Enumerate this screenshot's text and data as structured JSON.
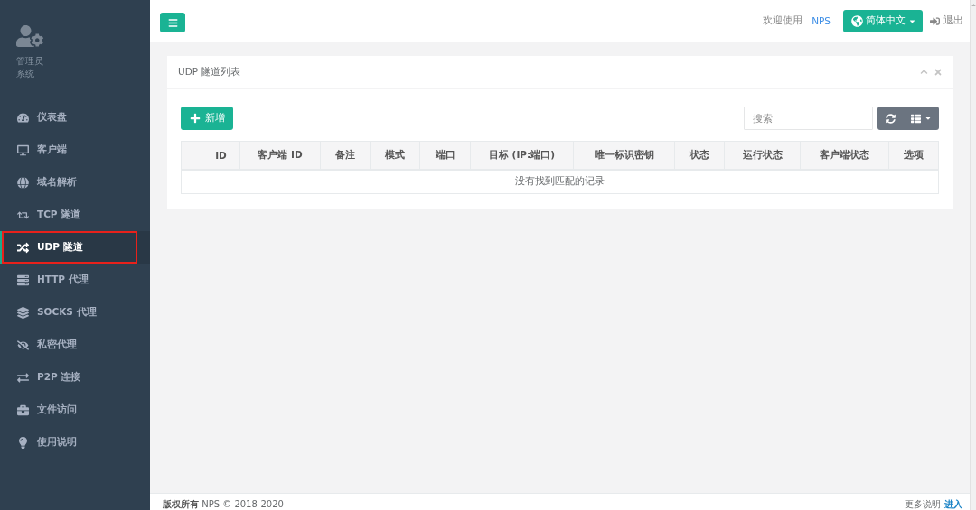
{
  "sidebar": {
    "profile": {
      "name": "管理员",
      "role": "系统"
    },
    "menu": [
      {
        "label": "仪表盘",
        "selected": false,
        "annotated": false
      },
      {
        "label": "客户端",
        "selected": false,
        "annotated": false
      },
      {
        "label": "域名解析",
        "selected": false,
        "annotated": false
      },
      {
        "label": "TCP 隧道",
        "selected": false,
        "annotated": false
      },
      {
        "label": "UDP 隧道",
        "selected": true,
        "annotated": true
      },
      {
        "label": "HTTP 代理",
        "selected": false,
        "annotated": false
      },
      {
        "label": "SOCKS 代理",
        "selected": false,
        "annotated": false
      },
      {
        "label": "私密代理",
        "selected": false,
        "annotated": false
      },
      {
        "label": "P2P 连接",
        "selected": false,
        "annotated": false
      },
      {
        "label": "文件访问",
        "selected": false,
        "annotated": false
      },
      {
        "label": "使用说明",
        "selected": false,
        "annotated": false
      }
    ]
  },
  "navbar": {
    "welcome": "欢迎使用",
    "user": "NPS",
    "language": "简体中文",
    "logout": "退出"
  },
  "panel": {
    "title": "UDP 隧道列表",
    "add_button": "新增",
    "search": {
      "placeholder": "搜索"
    },
    "table": {
      "columns": [
        "ID",
        "客户端 ID",
        "备注",
        "模式",
        "端口",
        "目标 (IP:端口)",
        "唯一标识密钥",
        "状态",
        "运行状态",
        "客户端状态",
        "选项"
      ],
      "empty_message": "没有找到匹配的记录"
    }
  },
  "footer": {
    "copyright": "**版权所有** NPS © 2018-2020",
    "more": "更多说明",
    "link": "进入"
  }
}
